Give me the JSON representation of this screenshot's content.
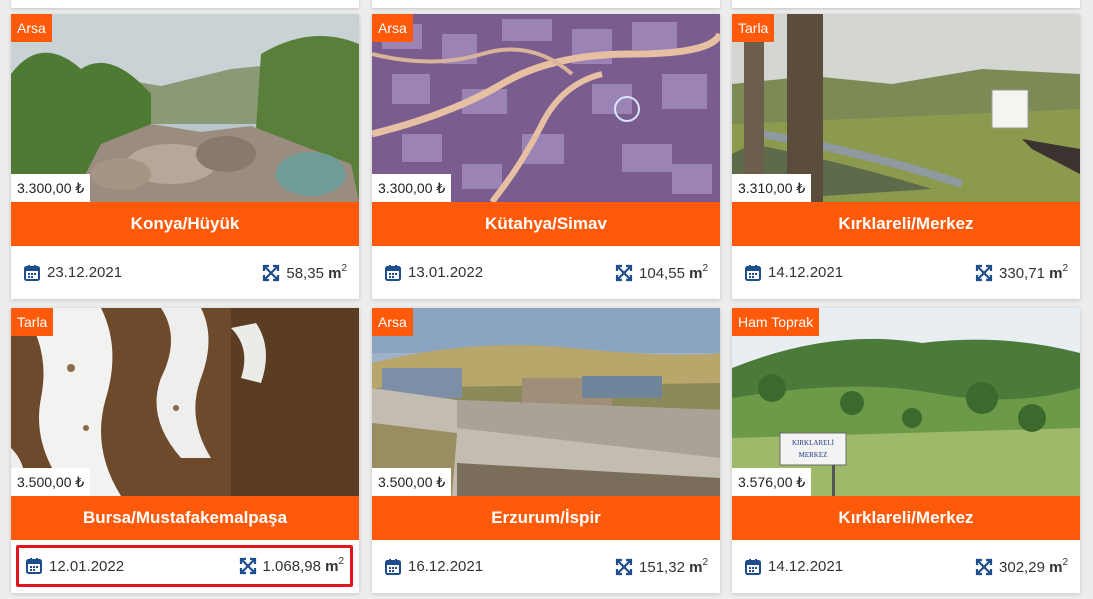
{
  "listings": [
    {
      "type": "Arsa",
      "price": "3.300,00 ₺",
      "location": "Konya/Hüyük",
      "date": "23.12.2021",
      "area": "58,35",
      "unit": "m",
      "unit_sup": "2"
    },
    {
      "type": "Arsa",
      "price": "3.300,00 ₺",
      "location": "Kütahya/Simav",
      "date": "13.01.2022",
      "area": "104,55",
      "unit": "m",
      "unit_sup": "2"
    },
    {
      "type": "Tarla",
      "price": "3.310,00 ₺",
      "location": "Kırklareli/Merkez",
      "date": "14.12.2021",
      "area": "330,71",
      "unit": "m",
      "unit_sup": "2"
    },
    {
      "type": "Tarla",
      "price": "3.500,00 ₺",
      "location": "Bursa/Mustafakemalpaşa",
      "date": "12.01.2022",
      "area": "1.068,98",
      "unit": "m",
      "unit_sup": "2"
    },
    {
      "type": "Arsa",
      "price": "3.500,00 ₺",
      "location": "Erzurum/İspir",
      "date": "16.12.2021",
      "area": "151,32",
      "unit": "m",
      "unit_sup": "2"
    },
    {
      "type": "Ham Toprak",
      "price": "3.576,00 ₺",
      "location": "Kırklareli/Merkez",
      "date": "14.12.2021",
      "area": "302,29",
      "unit": "m",
      "unit_sup": "2"
    }
  ],
  "signage": {
    "line1": "KIRKLARELİ",
    "line2": "MERKEZ"
  },
  "icons": {
    "date": "calendar-icon",
    "area": "expand-arrows-icon"
  },
  "colors": {
    "accent": "#ff5a0a",
    "highlight": "#e3141e",
    "icon": "#1e4d8c"
  }
}
